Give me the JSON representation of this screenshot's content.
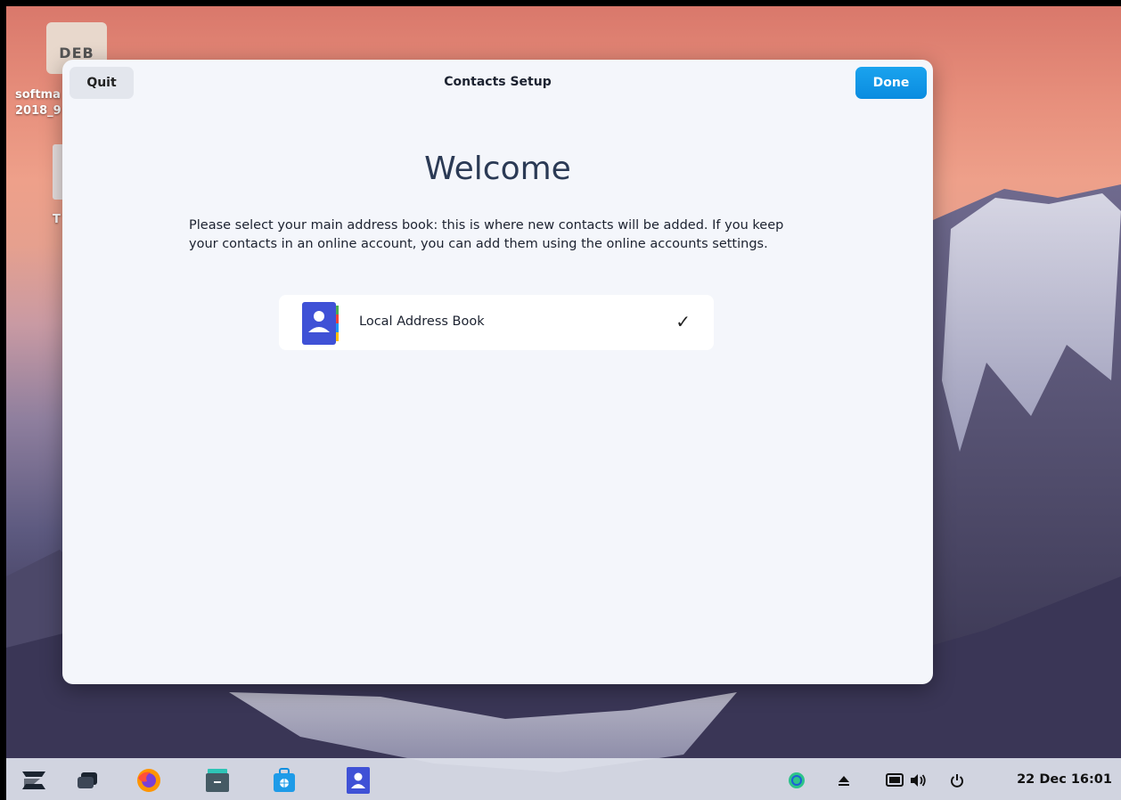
{
  "desktop": {
    "icons": [
      {
        "label": "softma",
        "sublabel": "2018_9",
        "badge": "DEB"
      },
      {
        "label": "T"
      }
    ]
  },
  "dialog": {
    "title": "Contacts Setup",
    "quit_label": "Quit",
    "done_label": "Done",
    "heading": "Welcome",
    "description": "Please select your main address book: this is where new contacts will be added. If you keep your contacts in an online account, you can add them using the online accounts settings.",
    "address_books": [
      {
        "label": "Local Address Book",
        "selected": true,
        "icon": "address-book-icon"
      }
    ],
    "check_glyph": "✓"
  },
  "taskbar": {
    "apps": [
      {
        "name": "zorin-menu-icon"
      },
      {
        "name": "workspaces-icon"
      },
      {
        "name": "firefox-icon"
      },
      {
        "name": "files-icon"
      },
      {
        "name": "software-store-icon"
      },
      {
        "name": "contacts-icon"
      }
    ],
    "tray": [
      {
        "name": "update-icon"
      },
      {
        "name": "eject-icon"
      },
      {
        "name": "display-icon"
      },
      {
        "name": "volume-icon"
      },
      {
        "name": "power-icon"
      }
    ],
    "clock": "22 Dec  16:01"
  },
  "colors": {
    "accent": "#0a8ce0",
    "dialog_bg": "#f4f6fb"
  }
}
